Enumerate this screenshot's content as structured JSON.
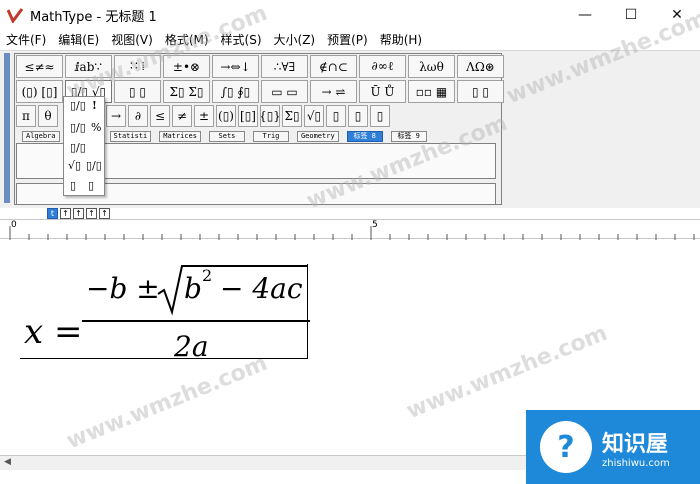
{
  "window": {
    "title": "MathType - 无标题 1",
    "minimize_glyph": "—",
    "maximize_glyph": "☐",
    "close_glyph": "✕"
  },
  "menu": [
    {
      "label": "文件(F)"
    },
    {
      "label": "编辑(E)"
    },
    {
      "label": "视图(V)"
    },
    {
      "label": "格式(M)"
    },
    {
      "label": "样式(S)"
    },
    {
      "label": "大小(Z)"
    },
    {
      "label": "预置(P)"
    },
    {
      "label": "帮助(H)"
    }
  ],
  "toolbar_row1": [
    "≤≠≈",
    "ⅈab∵",
    "∷ ⁞",
    "±•⊗",
    "→⇔↓",
    "∴∀∃",
    "∉∩⊂",
    "∂∞ℓ",
    "λωθ",
    "ΛΩ⊛"
  ],
  "toolbar_row2": [
    "(▯) [▯]",
    "▯/▯ √▯",
    "▯ ▯",
    "Σ▯ Σ▯",
    "∫▯ ∮▯",
    "▭ ▭",
    "→ ⇌",
    "Ū Ů",
    "▫▫ ▦",
    "▯ ▯"
  ],
  "toolbar_row3": [
    "π",
    "θ",
    "",
    "→",
    "∂",
    "≤",
    "≠",
    "±",
    "(▯)",
    "[▯]",
    "{▯}",
    "Σ▯",
    "√▯",
    "▯",
    "▯",
    "▯"
  ],
  "tabs": [
    {
      "label": "Algebra",
      "active": false
    },
    {
      "label": "Statisti",
      "active": false
    },
    {
      "label": "Matrices",
      "active": false
    },
    {
      "label": "Sets",
      "active": false
    },
    {
      "label": "Trig",
      "active": false
    },
    {
      "label": "Geometry",
      "active": false
    },
    {
      "label": "标签 8",
      "active": true
    },
    {
      "label": "标签 9",
      "active": false
    }
  ],
  "dropdown_items": [
    "▯/▯",
    "▯/▯",
    "▯/▯",
    "√▯",
    "▯/▯",
    "▯",
    "▯"
  ],
  "size_buttons": [
    {
      "label": "t",
      "active": true
    },
    {
      "label": "↑",
      "active": false
    },
    {
      "label": "↑",
      "active": false
    },
    {
      "label": "↑",
      "active": false
    },
    {
      "label": "↑",
      "active": false
    }
  ],
  "ruler": {
    "mark_0": "0",
    "mark_5": "5"
  },
  "equation": {
    "lhs": "x",
    "equals": "=",
    "numerator_prefix": "−b ±",
    "radicand_b": "b",
    "radicand_exp": "2",
    "radicand_rest": "− 4ac",
    "denominator": "2a"
  },
  "watermark": {
    "text": "www.wmzhe.com",
    "logo_title": "知识屋",
    "logo_sub": "zhishiwu.com",
    "logo_symbol": "?"
  },
  "colors": {
    "accent": "#2f7fd8",
    "logo_bg": "#1e88d9",
    "app_icon_red": "#c0392b"
  }
}
